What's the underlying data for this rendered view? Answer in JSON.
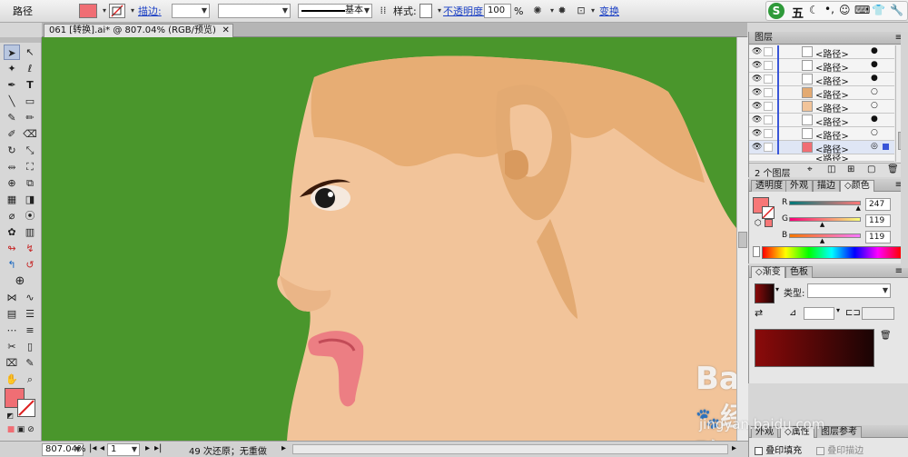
{
  "control_bar": {
    "object_type": "路径",
    "stroke_label": "描边:",
    "stroke_profile": "基本",
    "style_label": "样式:",
    "opacity_label": "不透明度:",
    "opacity_value": "100",
    "opacity_unit": "%",
    "transform_label": "变换",
    "fill_color": "#f06e74"
  },
  "ime_bar": {
    "mode": "五"
  },
  "document": {
    "tab_title": "061 [转换].ai* @ 807.04% (RGB/预览)",
    "tab_close": "✕"
  },
  "status": {
    "zoom": "807.04%",
    "page": "1",
    "message": "49 次还原；无重做"
  },
  "layers_panel": {
    "title": "图层",
    "rows": [
      {
        "name": "<路径>",
        "target": "●"
      },
      {
        "name": "<路径>",
        "target": "●"
      },
      {
        "name": "<路径>",
        "target": "●"
      },
      {
        "name": "<路径>",
        "target": "○"
      },
      {
        "name": "<路径>",
        "target": "○"
      },
      {
        "name": "<路径>",
        "target": "●"
      },
      {
        "name": "<路径>",
        "target": "○"
      },
      {
        "name": "<路径>",
        "target": "◎"
      }
    ],
    "partial_row": "<路径>",
    "footer": "2 个图层"
  },
  "color_panel": {
    "tabs": [
      "透明度",
      "外观",
      "描边",
      "颜色"
    ],
    "active_tab": "颜色",
    "channels": [
      {
        "label": "R",
        "value": "247",
        "position": 0.969
      },
      {
        "label": "G",
        "value": "119",
        "position": 0.467
      },
      {
        "label": "B",
        "value": "119",
        "position": 0.467
      }
    ]
  },
  "gradient_panel": {
    "tabs": [
      "渐变",
      "色板"
    ],
    "type_label": "类型:",
    "from_color": "#8b0a0a",
    "to_color": "#1a0404"
  },
  "bottom_panel": {
    "tabs": [
      "外观",
      "属性",
      "图层参考"
    ],
    "fill_check": "叠印填充",
    "stroke_check": "叠印描边"
  },
  "watermark": {
    "logo": "Bai",
    "logo_cn": "经验",
    "url": "jingyan.baidu.com"
  }
}
